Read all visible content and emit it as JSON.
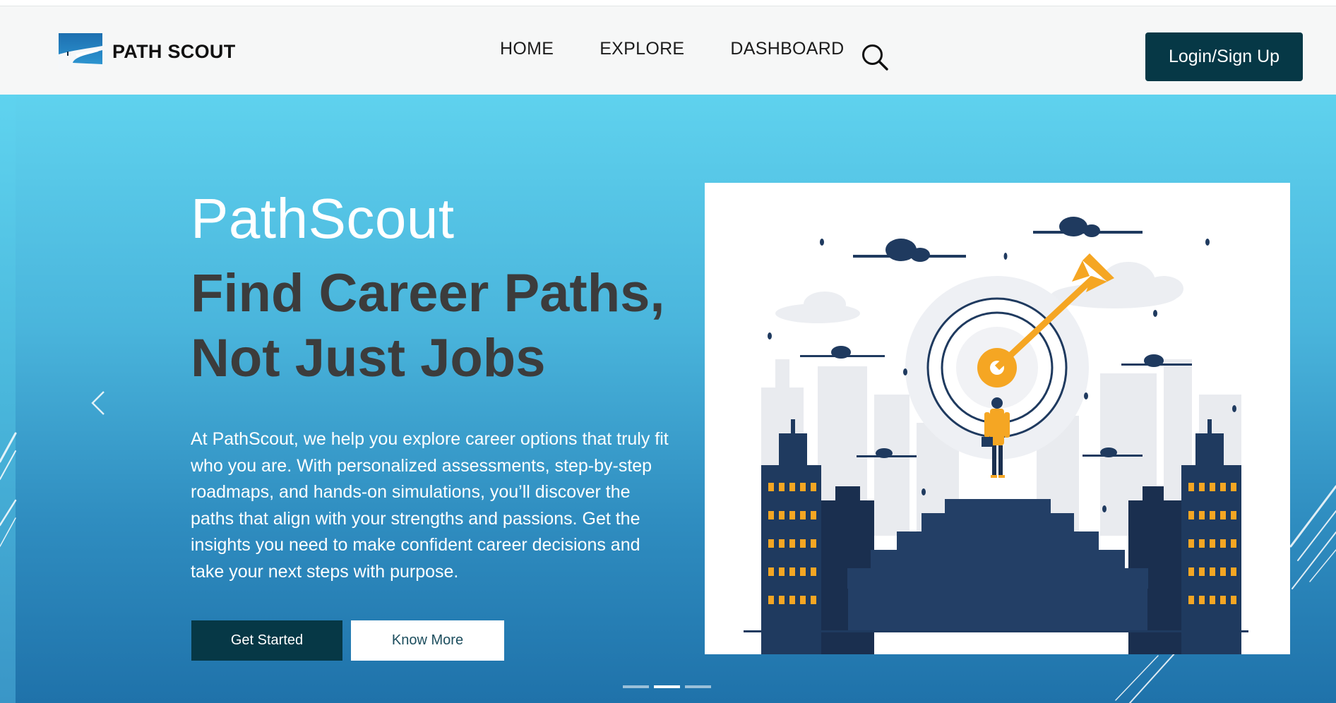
{
  "brand": {
    "name": "PATH SCOUT",
    "logo_icon": "road-logo-icon"
  },
  "nav": {
    "links": [
      {
        "label": "HOME"
      },
      {
        "label": "EXPLORE"
      },
      {
        "label": "DASHBOARD"
      }
    ],
    "search_icon": "search-icon",
    "login_label": "Login/Sign Up"
  },
  "hero": {
    "title": "PathScout",
    "heading_line1": "Find Career Paths,",
    "heading_line2": "Not Just Jobs",
    "description": "At PathScout, we help you explore career options that truly fit who you are. With personalized assessments, step-by-step roadmaps, and hands-on simulations, you’ll discover the paths that align with your strengths and passions. Get the insights you need to make confident career decisions and take your next steps with purpose.",
    "primary_button": "Get Started",
    "secondary_button": "Know More",
    "prev_icon": "chevron-left-icon",
    "carousel": {
      "slides": 3,
      "active_slide": 2
    }
  },
  "colors": {
    "dark_teal": "#063846",
    "hero_top": "#5fd2ee",
    "hero_bottom": "#1f72aa",
    "heading_gray": "#3c3c3c",
    "illustration_navy": "#1f3a5f",
    "illustration_orange": "#f5a623"
  }
}
